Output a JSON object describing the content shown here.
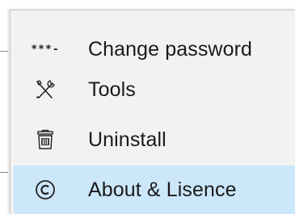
{
  "menu": {
    "items": [
      {
        "label": "Change password",
        "icon": "password-icon",
        "highlighted": false
      },
      {
        "label": "Tools",
        "icon": "tools-icon",
        "highlighted": false
      },
      {
        "label": "Uninstall",
        "icon": "trash-icon",
        "highlighted": false
      },
      {
        "label": "About & Lisence",
        "icon": "copyright-icon",
        "highlighted": true
      }
    ],
    "password_icon_glyph": "***-"
  },
  "colors": {
    "menu_background": "#f2f2f2",
    "highlight": "#cce6fa",
    "text": "#1a1a1a"
  }
}
